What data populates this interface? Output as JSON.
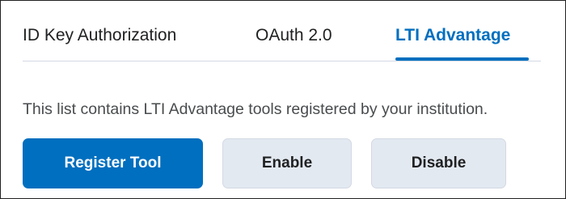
{
  "tabs": [
    {
      "label": "ID Key Authorization",
      "active": false
    },
    {
      "label": "OAuth 2.0",
      "active": false
    },
    {
      "label": "LTI Advantage",
      "active": true
    }
  ],
  "description": "This list contains LTI Advantage tools registered by your institution.",
  "actions": {
    "register_label": "Register Tool",
    "enable_label": "Enable",
    "disable_label": "Disable"
  },
  "colors": {
    "accent": "#006fbf",
    "secondary_button_bg": "#e3e9f1",
    "text": "#202122",
    "muted_text": "#494c4e",
    "divider": "#d3d9e3"
  }
}
